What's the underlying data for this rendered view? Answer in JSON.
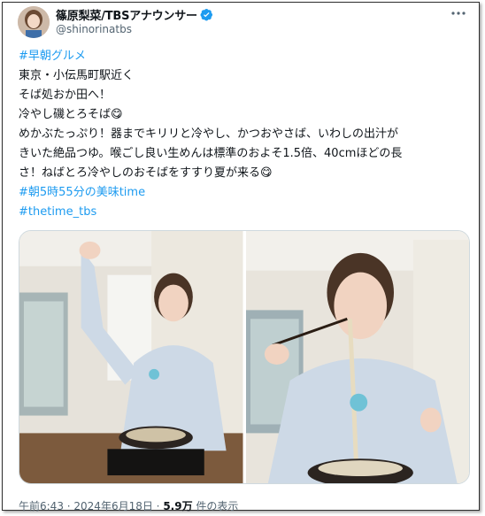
{
  "author": {
    "name": "篠原梨菜/TBSアナウンサー",
    "handle": "@shinorinatbs"
  },
  "post": {
    "hashtag_top": "#早朝グルメ",
    "line1": "東京・小伝馬町駅近く",
    "line2": "そば処おか田へ！",
    "line3": "冷やし磯とろそば",
    "line3_emoji": "😋",
    "line4a": "めかぶたっぷり！器までキリリと冷やし、かつおやさば、いわしの出汁が",
    "line4b": "きいた絶品つゆ。喉ごし良い生めんは標準のおよそ1.5倍、40cmほどの長",
    "line4c": "さ！ねばとろ冷やしのおそばをすすり夏が来る",
    "line4_emoji": "😋",
    "hashtag_time": "#朝5時55分の美味time",
    "hashtag_show": "#thetime_tbs"
  },
  "meta": {
    "time": "午前6:43",
    "sep1": " · ",
    "date": "2024年6月18日",
    "sep2": " · ",
    "views_count": "5.9万",
    "views_label": " 件の表示"
  },
  "icons": {
    "verified": "verified-badge-icon",
    "more": "more-options-icon"
  },
  "colors": {
    "accent": "#1d9bf0",
    "text": "#0f1419",
    "secondary": "#536471"
  }
}
